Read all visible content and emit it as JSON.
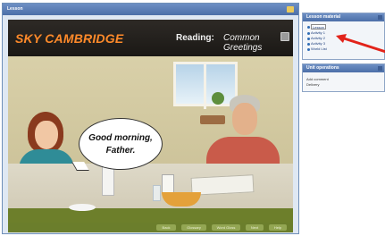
{
  "lesson": {
    "title": "Lesson",
    "brand": "SKY CAMBRIDGE",
    "reading_label": "Reading:",
    "reading_title": "Common Greetings",
    "speech_line1": "Good morning,",
    "speech_line2": "Father.",
    "controls": [
      "Back",
      "Glossary",
      "Word Gloss",
      "Next",
      "Help"
    ]
  },
  "material": {
    "title": "Lesson material",
    "items": [
      "Lesson",
      "Activity 1",
      "Activity 2",
      "Activity 3",
      "World List"
    ]
  },
  "unit_operations": {
    "title": "Unit operations",
    "items": [
      "Add comment",
      "Delivery"
    ]
  },
  "colors": {
    "header_blue": "#4c6fa8",
    "brand_orange": "#ff8a2a",
    "annotation_red": "#e2231a"
  }
}
